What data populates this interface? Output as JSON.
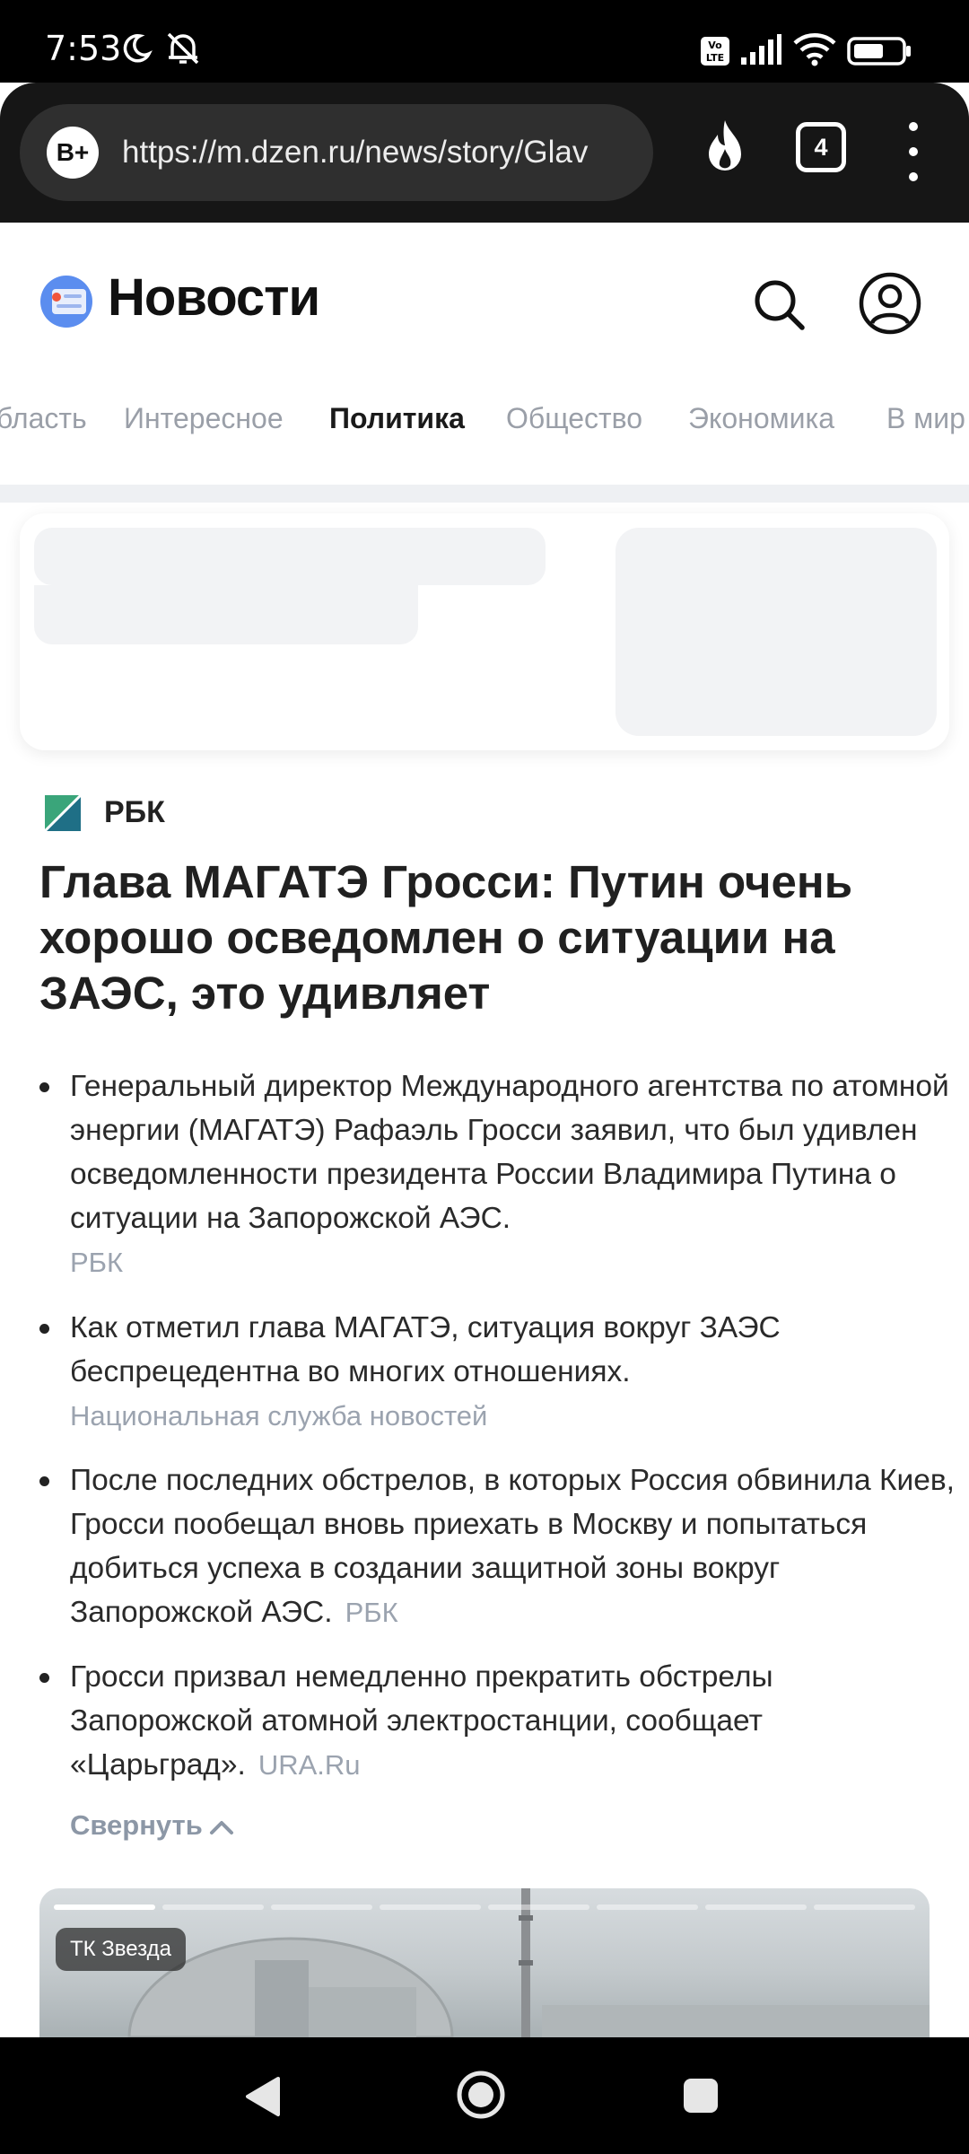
{
  "status_bar": {
    "time": "7:53",
    "icons": [
      "moon-icon",
      "alarm-off-icon",
      "volte-icon",
      "signal-icon",
      "wifi-icon",
      "battery-icon"
    ]
  },
  "browser": {
    "badge": "B+",
    "url": "https://m.dzen.ru/news/story/Glav",
    "tabs_count": "4",
    "icons": [
      "fire-icon",
      "more-vert-icon"
    ]
  },
  "header": {
    "title": "Новости",
    "icons": [
      "news-logo-icon",
      "search-icon",
      "profile-icon"
    ]
  },
  "categories": {
    "items": [
      "бласть",
      "Интересное",
      "Политика",
      "Общество",
      "Экономика",
      "В мир"
    ],
    "active": "Политика"
  },
  "article": {
    "source": "РБК",
    "headline": "Глава МАГАТЭ Гросси: Путин очень хорошо осведомлен о ситуации на ЗАЭС, это удивляет",
    "summary": [
      {
        "text": "Генеральный директор Международного агентства по атомной энергии (МАГАТЭ) Рафаэль Гросси заявил, что был удивлен осведомленности президента России Владимира Путина о ситуации на Запорожской АЭС.",
        "source": "РБК"
      },
      {
        "text": "Как отметил глава МАГАТЭ, ситуация вокруг ЗАЭС беспрецедентна во многих отношениях.",
        "source": "Национальная служба новостей"
      },
      {
        "text": "После последних обстрелов, в которых Россия обвинила Киев, Гросси пообещал вновь приехать в Москву и попытаться добиться успеха в создании защитной зоны вокруг Запорожской АЭС.",
        "source": "РБК"
      },
      {
        "text": "Гросси призвал немедленно прекратить обстрелы Запорожской атомной электростанции, сообщает «Царьград».",
        "source": "URA.Ru"
      }
    ],
    "collapse_label": "Свернуть"
  },
  "video": {
    "source_badge": "ТК Звезда",
    "story_segments_total": 8,
    "story_segments_viewed": 1
  },
  "colors": {
    "accent_text": "#1a1a1a",
    "muted_text": "#9ba3af",
    "chrome_bg": "#161616"
  }
}
